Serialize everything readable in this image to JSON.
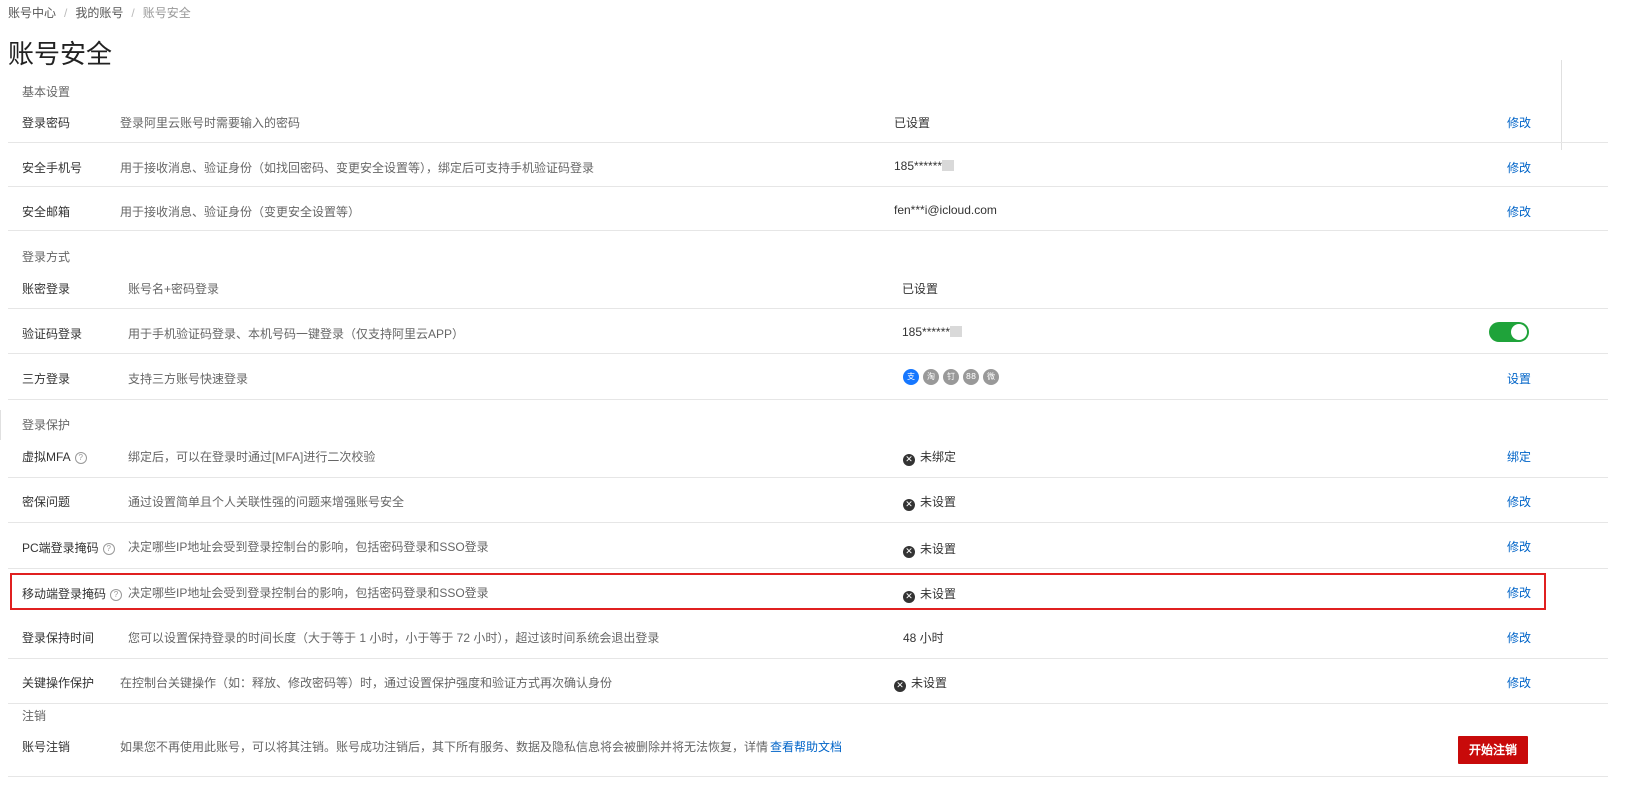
{
  "breadcrumb": [
    "账号中心",
    "我的账号",
    "账号安全"
  ],
  "page_title": "账号安全",
  "sections": {
    "basic": "基本设置",
    "login_method": "登录方式",
    "login_protect": "登录保护",
    "cancel": "注销"
  },
  "basic_rows": [
    {
      "label": "登录密码",
      "desc": "登录阿里云账号时需要输入的密码",
      "status": "已设置",
      "action": "修改"
    },
    {
      "label": "安全手机号",
      "desc": "用于接收消息、验证身份（如找回密码、变更安全设置等），绑定后可支持手机验证码登录",
      "status": "185******",
      "action": "修改"
    },
    {
      "label": "安全邮箱",
      "desc": "用于接收消息、验证身份（变更安全设置等）",
      "status": "fen***i@icloud.com",
      "action": "修改"
    }
  ],
  "login_rows": [
    {
      "label": "账密登录",
      "desc": "账号名+密码登录",
      "status": "已设置"
    },
    {
      "label": "验证码登录",
      "desc": "用于手机验证码登录、本机号码一键登录（仅支持阿里云APP）",
      "status": "185******",
      "toggle_on": true
    },
    {
      "label": "三方登录",
      "desc": "支持三方账号快速登录",
      "action": "设置",
      "icons": [
        "alipay-icon",
        "taobao-icon",
        "dingtalk-icon",
        "1688-icon",
        "weibo-icon"
      ],
      "icon_glyphs": [
        "支",
        "淘",
        "钉",
        "88",
        "微"
      ]
    }
  ],
  "protect_rows": [
    {
      "label": "虚拟MFA",
      "help": true,
      "desc": "绑定后，可以在登录时通过[MFA]进行二次校验",
      "status": "未绑定",
      "status_icon": true,
      "action": "绑定"
    },
    {
      "label": "密保问题",
      "help": false,
      "desc": "通过设置简单且个人关联性强的问题来增强账号安全",
      "status": "未设置",
      "status_icon": true,
      "action": "修改"
    },
    {
      "label": "PC端登录掩码",
      "help": true,
      "desc": "决定哪些IP地址会受到登录控制台的影响，包括密码登录和SSO登录",
      "status": "未设置",
      "status_icon": true,
      "action": "修改"
    },
    {
      "label": "移动端登录掩码",
      "help": true,
      "desc": "决定哪些IP地址会受到登录控制台的影响，包括密码登录和SSO登录",
      "status": "未设置",
      "status_icon": true,
      "action": "修改"
    },
    {
      "label": "登录保持时间",
      "help": false,
      "desc": "您可以设置保持登录的时间长度（大于等于 1 小时，小于等于 72 小时），超过该时间系统会退出登录",
      "status": "48 小时",
      "status_icon": false,
      "action": "修改"
    },
    {
      "label": "关键操作保护",
      "help": false,
      "desc": "在控制台关键操作（如：释放、修改密码等）时，通过设置保护强度和验证方式再次确认身份",
      "status": "未设置",
      "status_icon": true,
      "action": "修改"
    }
  ],
  "cancel_row": {
    "label": "账号注销",
    "desc": "如果您不再使用此账号，可以将其注销。账号成功注销后，其下所有服务、数据及隐私信息将会被删除并将无法恢复，详情",
    "link": "查看帮助文档",
    "button": "开始注销"
  },
  "colors": {
    "accent": "#0064c8",
    "danger": "#c80a0a",
    "toggle_on": "#1fa33a",
    "highlight": "#e02020"
  }
}
